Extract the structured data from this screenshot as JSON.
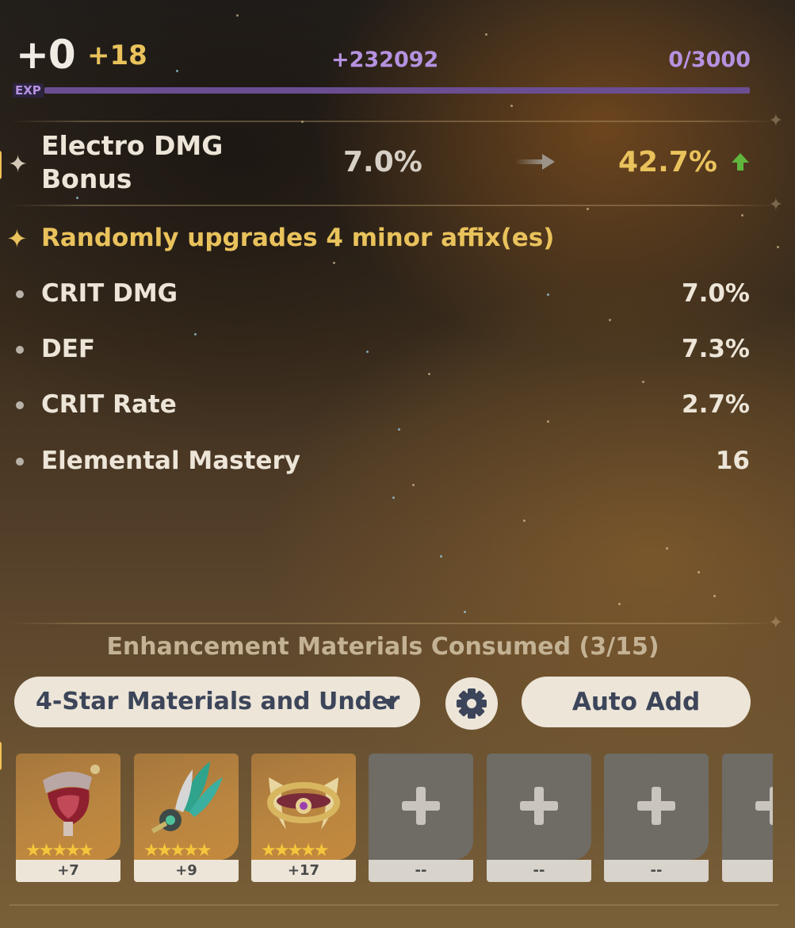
{
  "level": {
    "current": "+0",
    "gain": "+18"
  },
  "exp": {
    "gain": "+232092",
    "value": "0/3000",
    "label": "EXP",
    "fill_fraction": 1.0
  },
  "main_stat": {
    "name": "Electro DMG Bonus",
    "old_value": "7.0%",
    "new_value": "42.7%"
  },
  "upgrade_notice": "Randomly upgrades 4 minor affix(es)",
  "sub_stats": [
    {
      "name": "CRIT DMG",
      "value": "7.0%"
    },
    {
      "name": "DEF",
      "value": "7.3%"
    },
    {
      "name": "CRIT Rate",
      "value": "2.7%"
    },
    {
      "name": "Elemental Mastery",
      "value": "16"
    }
  ],
  "materials": {
    "title": "Enhancement Materials Consumed (3/15)",
    "filter_label": "4-Star Materials and Under",
    "auto_add_label": "Auto Add",
    "slots": [
      {
        "type": "filled",
        "icon": "goblet-artifact-icon",
        "rarity": 5,
        "stars": "★★★★★",
        "caption": "+7"
      },
      {
        "type": "filled",
        "icon": "feather-artifact-icon",
        "rarity": 5,
        "stars": "★★★★★",
        "caption": "+9"
      },
      {
        "type": "filled",
        "icon": "circlet-artifact-icon",
        "rarity": 5,
        "stars": "★★★★★",
        "caption": "+17"
      },
      {
        "type": "empty",
        "icon": "plus-icon",
        "caption": "--"
      },
      {
        "type": "empty",
        "icon": "plus-icon",
        "caption": "--"
      },
      {
        "type": "empty",
        "icon": "plus-icon",
        "caption": "--"
      },
      {
        "type": "empty",
        "icon": "plus-icon",
        "caption": ""
      }
    ]
  },
  "colors": {
    "gold": "#e9c25c",
    "exp_purple": "#b592e0",
    "button_bg": "#ece5d8",
    "button_text": "#3c4559",
    "up_green": "#5fb53e"
  }
}
